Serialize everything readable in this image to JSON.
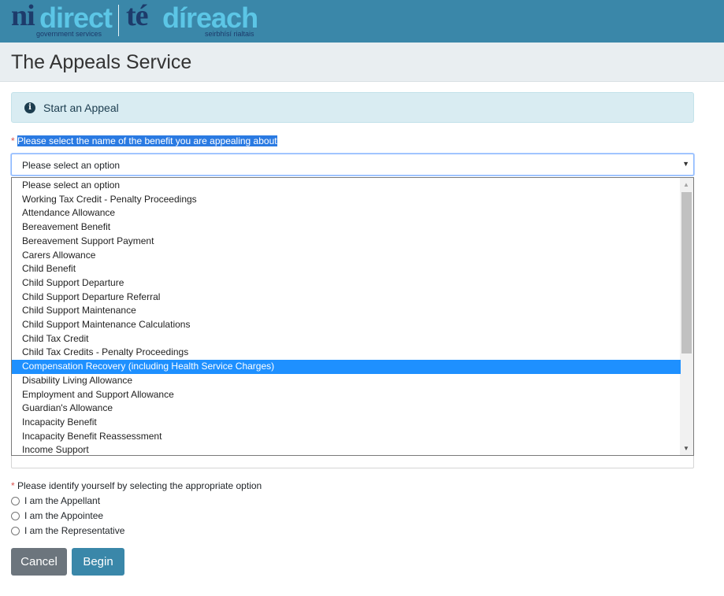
{
  "header": {
    "logo_ni": "ni",
    "logo_direct": "direct",
    "logo_gov_sub": "government services",
    "logo_te": "té",
    "logo_direach": "díreach",
    "logo_irish_sub": "seirbhísí rialtais",
    "brand_color": "#3a87a9"
  },
  "page": {
    "title": "The Appeals Service"
  },
  "alert": {
    "icon": "info-icon",
    "text": "Start an Appeal"
  },
  "benefit_question": {
    "required_mark": "*",
    "label": "Please select the name of the benefit you are appealing about",
    "select_value": "Please select an option",
    "options": [
      "Please select an option",
      "Working Tax Credit - Penalty Proceedings",
      "Attendance Allowance",
      "Bereavement Benefit",
      "Bereavement Support Payment",
      "Carers Allowance",
      "Child Benefit",
      "Child Support Departure",
      "Child Support Departure Referral",
      "Child Support Maintenance",
      "Child Support Maintenance Calculations",
      "Child Tax Credit",
      "Child Tax Credits - Penalty Proceedings",
      "Compensation Recovery (including Health Service Charges)",
      "Disability Living Allowance",
      "Employment and Support Allowance",
      "Guardian's Allowance",
      "Incapacity Benefit",
      "Incapacity Benefit Reassessment",
      "Income Support"
    ],
    "highlighted_option": "Compensation Recovery (including Health Service Charges)"
  },
  "identity_question": {
    "required_mark": "*",
    "label": "Please identify yourself by selecting the appropriate option",
    "options": [
      "I am the Appellant",
      "I am the Appointee",
      "I am the Representative"
    ]
  },
  "buttons": {
    "cancel": "Cancel",
    "begin": "Begin"
  }
}
